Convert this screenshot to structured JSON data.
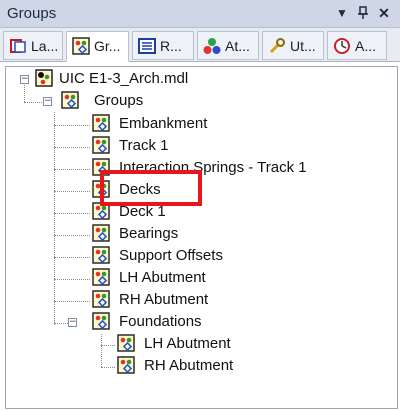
{
  "panel": {
    "title": "Groups",
    "pin_icon": "pin-icon",
    "dropdown_icon": "dropdown-icon",
    "close_icon": "close-icon"
  },
  "tabs": [
    {
      "label": "La...",
      "icon": "layers-icon"
    },
    {
      "label": "Gr...",
      "icon": "groups-icon",
      "active": true
    },
    {
      "label": "R...",
      "icon": "results-icon"
    },
    {
      "label": "At...",
      "icon": "attributes-icon"
    },
    {
      "label": "Ut...",
      "icon": "utilities-icon"
    },
    {
      "label": "A...",
      "icon": "analysis-icon"
    }
  ],
  "tree": {
    "root": "UIC E1-3_Arch.mdl",
    "groups": "Groups",
    "items": {
      "embankment": "Embankment",
      "track1": "Track 1",
      "interaction": "Interaction Springs - Track 1",
      "decks": "Decks",
      "deck1": "Deck 1",
      "bearings": "Bearings",
      "support_offsets": "Support Offsets",
      "lh_abutment": "LH Abutment",
      "rh_abutment": "RH Abutment",
      "foundations": "Foundations",
      "found_lh": "LH Abutment",
      "found_rh": "RH Abutment"
    },
    "expander_minus": "−"
  },
  "colors": {
    "highlight": "#e8151c",
    "header_bg": "#cfd6e5"
  }
}
